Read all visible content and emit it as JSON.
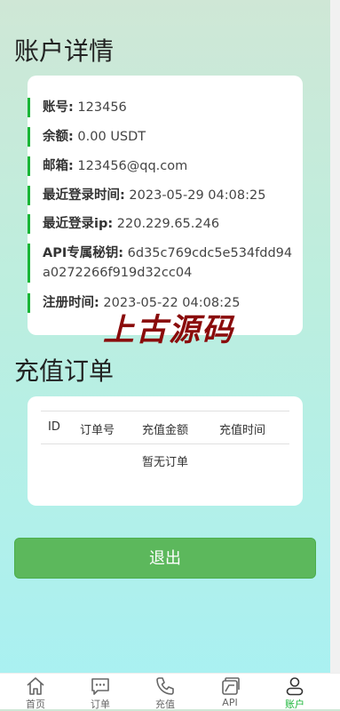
{
  "account_section": {
    "title": "账户详情",
    "rows": [
      {
        "label": "账号:",
        "value": "123456"
      },
      {
        "label": "余额:",
        "value": "0.00 USDT"
      },
      {
        "label": "邮箱:",
        "value": "123456@qq.com"
      },
      {
        "label": "最近登录时间:",
        "value": "2023-05-29 04:08:25"
      },
      {
        "label": "最近登录ip:",
        "value": "220.229.65.246"
      },
      {
        "label": "API专属秘钥:",
        "value": "6d35c769cdc5e534fdd94a0272266f919d32cc04"
      },
      {
        "label": "注册时间:",
        "value": "2023-05-22 04:08:25"
      }
    ]
  },
  "watermark": "上古源码",
  "orders_section": {
    "title": "充值订单",
    "columns": [
      "ID",
      "订单号",
      "充值金额",
      "充值时间"
    ],
    "empty_text": "暂无订单"
  },
  "logout_label": "退出",
  "tabbar": {
    "items": [
      {
        "label": "首页",
        "icon": "home-icon"
      },
      {
        "label": "订单",
        "icon": "chat-icon"
      },
      {
        "label": "充值",
        "icon": "phone-icon"
      },
      {
        "label": "API",
        "icon": "cards-icon"
      },
      {
        "label": "账户",
        "icon": "user-icon"
      }
    ],
    "active_index": 4,
    "active_color": "#19b537"
  },
  "colors": {
    "accent": "#19b537",
    "button": "#5cb85c"
  }
}
